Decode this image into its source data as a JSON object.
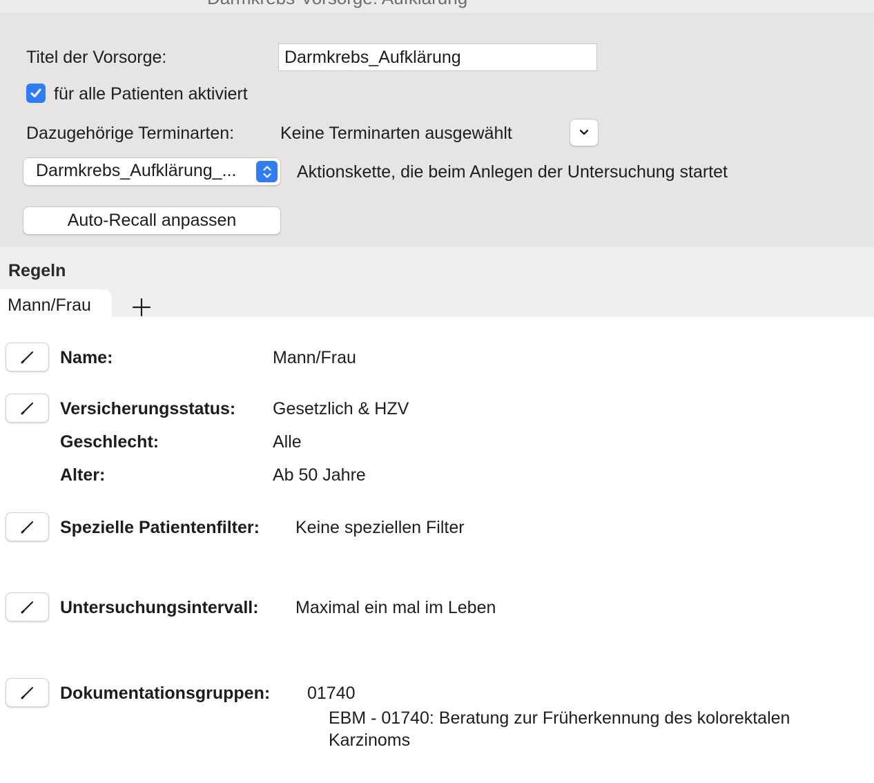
{
  "window": {
    "title_partial": "Darmkrebs-Vorsorge: Aufklärung"
  },
  "settings": {
    "title_label": "Titel der Vorsorge:",
    "title_value": "Darmkrebs_Aufklärung",
    "activate_all": {
      "label": "für alle Patienten aktiviert",
      "checked": true
    },
    "appointment_types_label": "Dazugehörige Terminarten:",
    "appointment_types_value": "Keine Terminarten ausgewählt",
    "action_chain_selected": "Darmkrebs_Aufklärung_...",
    "action_chain_desc": "Aktionskette, die beim Anlegen der Untersuchung startet",
    "auto_recall_button": "Auto-Recall anpassen",
    "accent_color": "#2f7cf6"
  },
  "rules": {
    "section_title": "Regeln",
    "tabs": [
      {
        "label": "Mann/Frau",
        "active": true
      }
    ],
    "add_tab_icon": "plus-icon",
    "fields": {
      "name": {
        "label": "Name:",
        "value": "Mann/Frau"
      },
      "insurance": {
        "label": "Versicherungsstatus:",
        "value": "Gesetzlich & HZV"
      },
      "gender": {
        "label": "Geschlecht:",
        "value": "Alle"
      },
      "age": {
        "label": "Alter:",
        "value": "Ab 50 Jahre"
      },
      "special_filters": {
        "label": "Spezielle Patientenfilter:",
        "value": "Keine speziellen Filter"
      },
      "interval": {
        "label": "Untersuchungsintervall:",
        "value": "Maximal ein mal im Leben"
      },
      "doc_groups": {
        "label": "Dokumentationsgruppen:",
        "value": "01740",
        "description": "EBM - 01740: Beratung zur Früherkennung des kolorektalen Karzinoms"
      }
    },
    "edit_icon": "pencil-icon"
  }
}
